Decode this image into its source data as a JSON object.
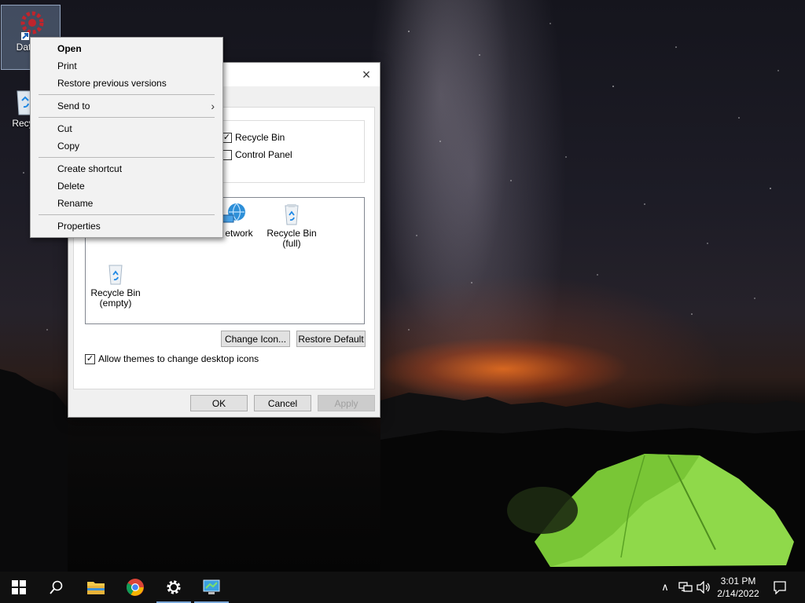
{
  "desktop": {
    "icons": [
      {
        "label_line1": "DataW",
        "label_line2": "o"
      },
      {
        "label": "Recyc"
      }
    ]
  },
  "dialog": {
    "close_glyph": "×",
    "checkboxes": [
      {
        "label": "Recycle Bin",
        "checked": true
      },
      {
        "label": "Control Panel",
        "checked": false
      }
    ],
    "icons": [
      {
        "label": "etwork"
      },
      {
        "label_line1": "Recycle Bin",
        "label_line2": "(full)"
      },
      {
        "label_line1": "Recycle Bin",
        "label_line2": "(empty)"
      }
    ],
    "change_icon_label": "Change Icon...",
    "restore_default_label": "Restore Default",
    "allow_themes_label": "Allow themes to change desktop icons",
    "allow_themes_checked": true,
    "ok_label": "OK",
    "cancel_label": "Cancel",
    "apply_label": "Apply"
  },
  "context_menu": {
    "items": [
      {
        "label": "Open"
      },
      {
        "label": "Print"
      },
      {
        "label": "Restore previous versions"
      },
      {
        "label": "Send to"
      },
      {
        "label": "Cut"
      },
      {
        "label": "Copy"
      },
      {
        "label": "Create shortcut"
      },
      {
        "label": "Delete"
      },
      {
        "label": "Rename"
      },
      {
        "label": "Properties"
      }
    ],
    "submenu_arrow": "›"
  },
  "taskbar": {
    "clock_time": "3:01 PM",
    "clock_date": "2/14/2022",
    "tray_chevron": "∧"
  },
  "icons": {
    "start": "windows-start-icon",
    "search": "search-icon",
    "explorer": "file-explorer-icon",
    "chrome": "chrome-icon",
    "settings": "gear-icon",
    "control_panel": "control-panel-icon",
    "network": "network-icon",
    "volume": "volume-icon",
    "notifications": "notification-icon"
  },
  "colors": {
    "accent": "#7aa7d8",
    "tent": "#9be34a",
    "horizon_glow": "#ff7a1e"
  }
}
